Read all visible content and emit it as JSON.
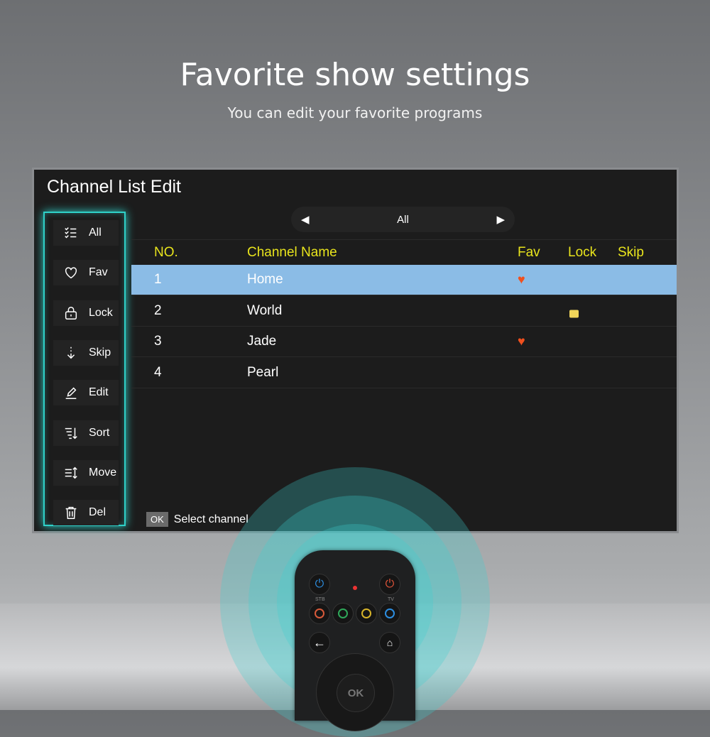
{
  "hero": {
    "title": "Favorite show settings",
    "subtitle": "You can edit your favorite programs"
  },
  "screen": {
    "title": "Channel List Edit",
    "sidebar": [
      {
        "label": "All",
        "icon": "checklist-icon"
      },
      {
        "label": "Fav",
        "icon": "heart-icon"
      },
      {
        "label": "Lock",
        "icon": "lock-icon"
      },
      {
        "label": "Skip",
        "icon": "arrow-down-icon"
      },
      {
        "label": "Edit",
        "icon": "pencil-icon"
      },
      {
        "label": "Sort",
        "icon": "sort-icon"
      },
      {
        "label": "Move",
        "icon": "move-icon"
      },
      {
        "label": "Del",
        "icon": "trash-icon"
      }
    ],
    "filter": "All",
    "columns": {
      "no": "NO.",
      "name": "Channel Name",
      "fav": "Fav",
      "lock": "Lock",
      "skip": "Skip"
    },
    "rows": [
      {
        "no": "1",
        "name": "Home",
        "fav": true,
        "lock": false,
        "selected": true
      },
      {
        "no": "2",
        "name": "World",
        "fav": false,
        "lock": true
      },
      {
        "no": "3",
        "name": "Jade",
        "fav": true,
        "lock": false
      },
      {
        "no": "4",
        "name": "Pearl",
        "fav": false,
        "lock": false
      }
    ],
    "footer": {
      "key": "OK",
      "hint": "Select channel"
    }
  },
  "remote": {
    "stb": "STB",
    "tv": "TV",
    "ok": "OK"
  },
  "colors": {
    "accent": "#2fd0c8",
    "header": "#e8e41c",
    "selected": "#8bbce6"
  }
}
